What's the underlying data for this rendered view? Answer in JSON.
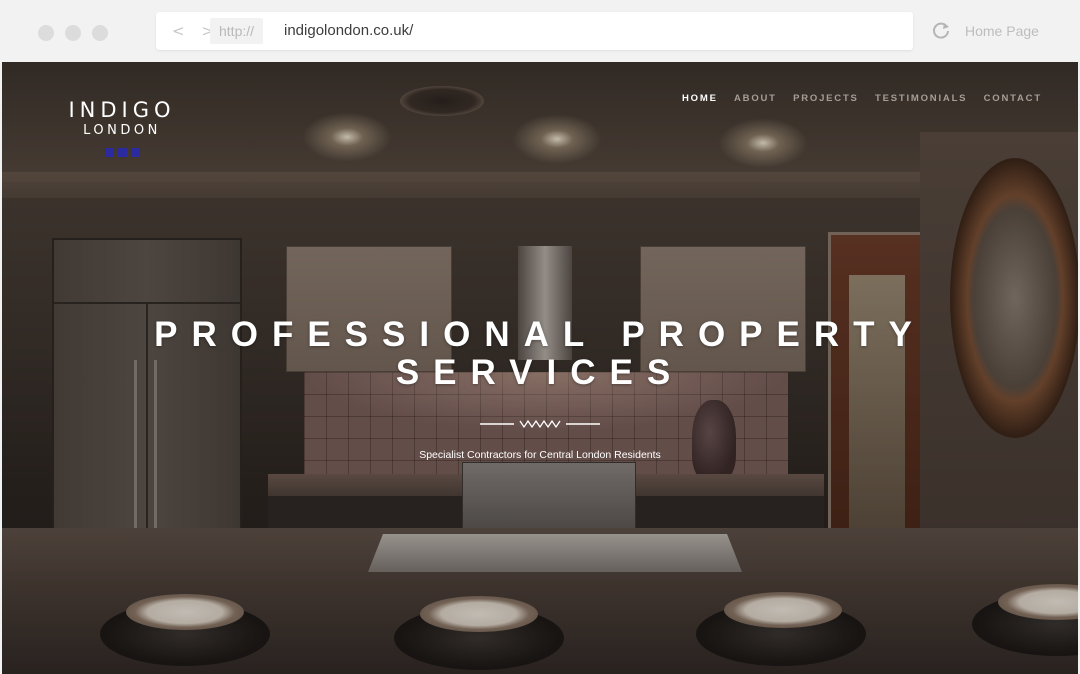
{
  "browser": {
    "protocol": "http://",
    "url": "indigolondon.co.uk/",
    "back_forward": "< >",
    "home_label": "Home Page"
  },
  "site": {
    "logo": {
      "line1": "INDIGO",
      "line2": "LONDON",
      "accent_color": "#2b2aa0"
    },
    "nav": [
      {
        "label": "HOME",
        "active": true
      },
      {
        "label": "ABOUT",
        "active": false
      },
      {
        "label": "PROJECTS",
        "active": false
      },
      {
        "label": "TESTIMONIALS",
        "active": false
      },
      {
        "label": "CONTACT",
        "active": false
      }
    ],
    "hero": {
      "headline_line1": "PROFESSIONAL PROPERTY",
      "headline_line2": "SERVICES",
      "tagline": "Specialist Contractors for Central London Residents"
    }
  }
}
